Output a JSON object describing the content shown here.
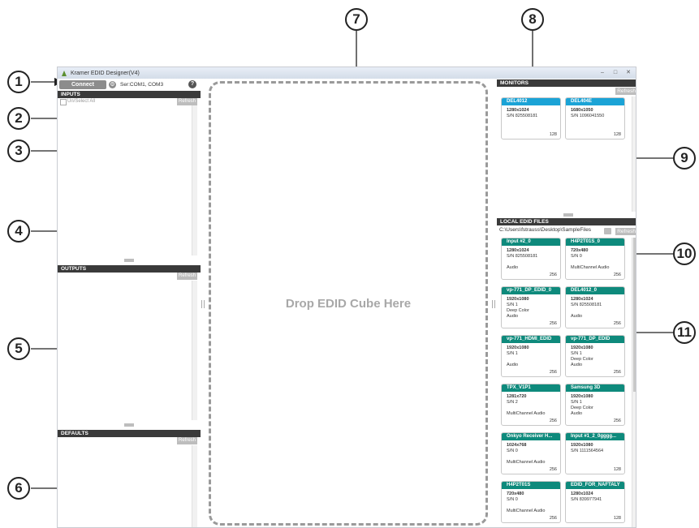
{
  "window": {
    "title": "Kramer EDID Designer(V4)",
    "controls": [
      "–",
      "□",
      "✕"
    ]
  },
  "toolbar": {
    "connect_label": "Connect",
    "gear_glyph": "⚙",
    "port_text": "Ser:COM1, COM3",
    "help_glyph": "?"
  },
  "inputs": {
    "header": "INPUTS",
    "select_all_label": "Un/Select All",
    "refresh_label": "Refresh"
  },
  "outputs": {
    "header": "OUTPUTS",
    "refresh_label": "Refresh"
  },
  "defaults": {
    "header": "DEFAULTS",
    "refresh_label": "Refresh"
  },
  "drop_zone": {
    "text": "Drop EDID Cube Here"
  },
  "monitors": {
    "header": "MONITORS",
    "refresh_label": "Refresh",
    "cards": [
      {
        "title": "DEL4012",
        "resolution": "1280x1024",
        "line2": "S/N 825508181",
        "line3": "",
        "line4": "",
        "size": "128"
      },
      {
        "title": "DEL404E",
        "resolution": "1680x1050",
        "line2": "S/N 1096041550",
        "line3": "",
        "line4": "",
        "size": "128"
      }
    ]
  },
  "local_edid": {
    "header": "LOCAL EDID FILES",
    "path": "C:\\Users\\fstrauss\\Desktop\\SampleFiles",
    "refresh_label": "Refresh",
    "cards": [
      {
        "title": "Input #2_0",
        "resolution": "1280x1024",
        "line2": "S/N 825508181",
        "line3": "",
        "line4": "Audio",
        "size": "256"
      },
      {
        "title": "H4P2T01S_0",
        "resolution": "720x480",
        "line2": "S/N 0",
        "line3": "",
        "line4": "MultiChannel Audio",
        "size": "256"
      },
      {
        "title": "vp-771_DP_EDID_0",
        "resolution": "1920x1080",
        "line2": "S/N 1",
        "line3": "Deep Color",
        "line4": "Audio",
        "size": "256"
      },
      {
        "title": "DEL4012_0",
        "resolution": "1280x1024",
        "line2": "S/N 825508181",
        "line3": "",
        "line4": "Audio",
        "size": "256"
      },
      {
        "title": "vp-771_HDMI_EDID",
        "resolution": "1920x1080",
        "line2": "S/N 1",
        "line3": "",
        "line4": "Audio",
        "size": "256"
      },
      {
        "title": "vp-771_DP_EDID",
        "resolution": "1920x1080",
        "line2": "S/N 1",
        "line3": "Deep Color",
        "line4": "Audio",
        "size": "256"
      },
      {
        "title": "TPX_V1P1",
        "resolution": "1281x720",
        "line2": "S/N 2",
        "line3": "",
        "line4": "MultiChannel Audio",
        "size": "256"
      },
      {
        "title": "Samsung 3D",
        "resolution": "1920x1080",
        "line2": "S/N 1",
        "line3": "Deep Color",
        "line4": "Audio",
        "size": "256"
      },
      {
        "title": "Onkyo Receiver H...",
        "resolution": "1024x768",
        "line2": "S/N 0",
        "line3": "",
        "line4": "MultiChannel Audio",
        "size": "256"
      },
      {
        "title": "Input #1_2_0gggg...",
        "resolution": "1920x1080",
        "line2": "S/N 1111564564",
        "line3": "",
        "line4": "",
        "size": "128"
      },
      {
        "title": "H4P2T01S",
        "resolution": "720x480",
        "line2": "S/N 0",
        "line3": "",
        "line4": "MultiChannel Audio",
        "size": "256"
      },
      {
        "title": "EDID_FOR_NAFTALY",
        "resolution": "1280x1024",
        "line2": "S/N 839977941",
        "line3": "",
        "line4": "",
        "size": "128"
      }
    ]
  },
  "callouts": [
    "1",
    "2",
    "3",
    "4",
    "5",
    "6",
    "7",
    "8",
    "9",
    "10",
    "11"
  ],
  "colors": {
    "monitor_card_title": "#1ba3d6",
    "local_card_title": "#0e8a7c",
    "section_header": "#3a3a3a"
  }
}
